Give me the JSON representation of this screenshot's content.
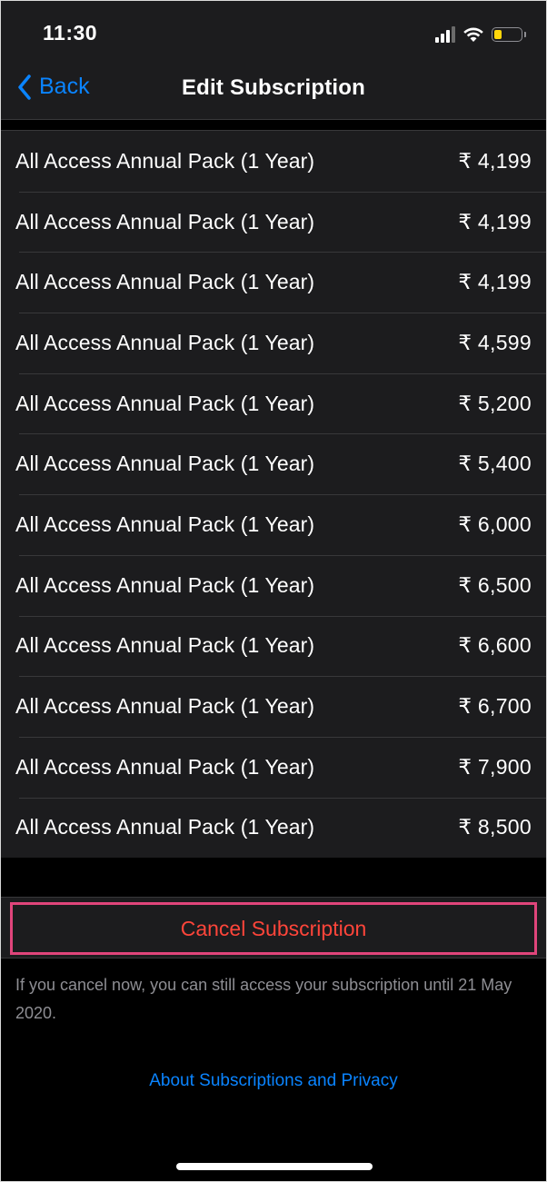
{
  "status_bar": {
    "time": "11:30",
    "icons": [
      "cellular-signal-icon",
      "wifi-icon",
      "battery-icon"
    ],
    "battery_color": "#ffd60a"
  },
  "nav": {
    "back_label": "Back",
    "title": "Edit Subscription"
  },
  "plans": [
    {
      "name": "All Access Annual Pack (1 Year)",
      "price": "₹ 4,199"
    },
    {
      "name": "All Access Annual Pack (1 Year)",
      "price": "₹ 4,199"
    },
    {
      "name": "All Access Annual Pack (1 Year)",
      "price": "₹ 4,199"
    },
    {
      "name": "All Access Annual Pack (1 Year)",
      "price": "₹ 4,599"
    },
    {
      "name": "All Access Annual Pack (1 Year)",
      "price": "₹ 5,200"
    },
    {
      "name": "All Access Annual Pack (1 Year)",
      "price": "₹ 5,400"
    },
    {
      "name": "All Access Annual Pack (1 Year)",
      "price": "₹ 6,000"
    },
    {
      "name": "All Access Annual Pack (1 Year)",
      "price": "₹ 6,500"
    },
    {
      "name": "All Access Annual Pack (1 Year)",
      "price": "₹ 6,600"
    },
    {
      "name": "All Access Annual Pack (1 Year)",
      "price": "₹ 6,700"
    },
    {
      "name": "All Access Annual Pack (1 Year)",
      "price": "₹ 7,900"
    },
    {
      "name": "All Access Annual Pack (1 Year)",
      "price": "₹ 8,500"
    }
  ],
  "cancel": {
    "label": "Cancel Subscription",
    "highlight_color": "#e0457b",
    "text_color": "#ff453a"
  },
  "footnote": "If you cancel now, you can still access your subscription until 21 May 2020.",
  "privacy_link": "About Subscriptions and Privacy",
  "colors": {
    "accent": "#0a84ff",
    "background": "#000000",
    "cell": "#1c1c1e"
  }
}
